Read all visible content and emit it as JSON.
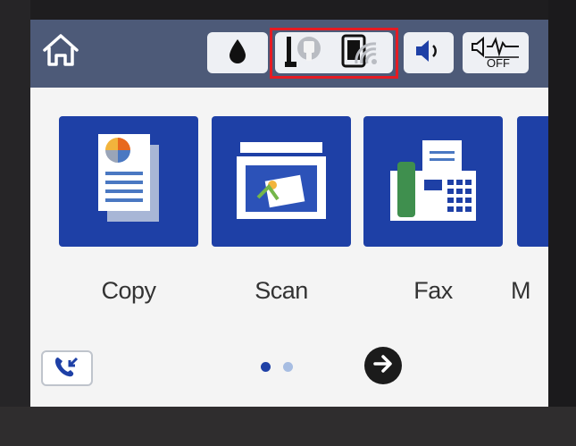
{
  "status_bar": {
    "icons": [
      "home-icon",
      "ink-drop-icon",
      "wired-lan-icon",
      "wifi-direct-icon",
      "speaker-icon",
      "fax-sound-off-icon"
    ],
    "mute_label": "OFF"
  },
  "menu": {
    "items": [
      {
        "label": "Copy",
        "icon": "copy-icon"
      },
      {
        "label": "Scan",
        "icon": "scan-icon"
      },
      {
        "label": "Fax",
        "icon": "fax-icon"
      },
      {
        "label": "M",
        "icon": "more-icon"
      }
    ],
    "tile_color": "#1e40a6"
  },
  "footer": {
    "page_indicator": {
      "pages": 2,
      "current": 1
    },
    "buttons": [
      "fax-log-icon",
      "next-arrow-icon"
    ]
  },
  "colors": {
    "status_bar_bg": "#4d5a78",
    "highlight": "#e51b23",
    "screen_bg": "#f4f4f4"
  }
}
